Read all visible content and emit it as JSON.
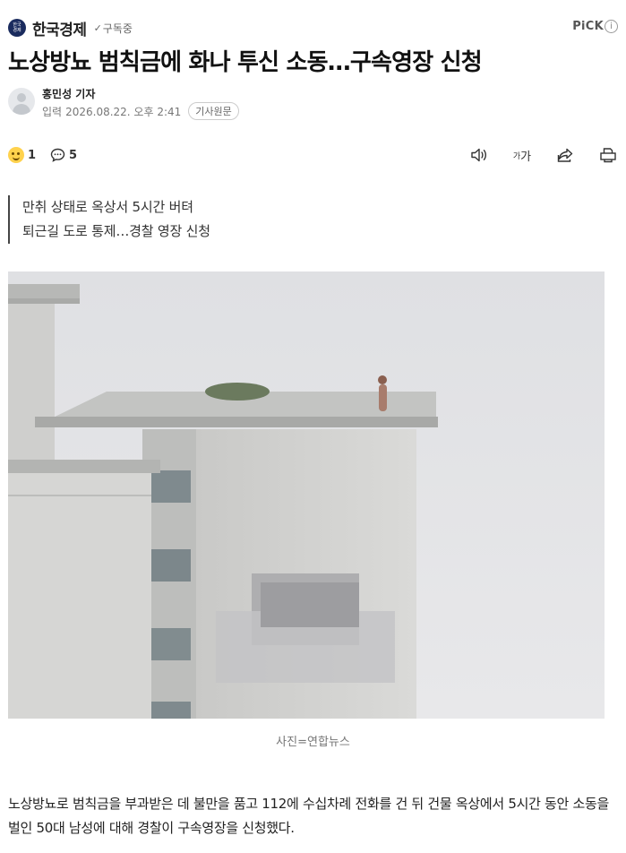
{
  "press": {
    "logo_text": "한국\n경제",
    "name": "한국경제",
    "subscribe_label": "구독중",
    "pick_label": "PiCK",
    "info_label": "i"
  },
  "article": {
    "headline": "노상방뇨 범칙금에 화나 투신 소동…구속영장 신청",
    "reporter": "홍민성 기자",
    "input_label": "입력",
    "published": "2026.08.22. 오후 2:41",
    "original_button": "기사원문",
    "reactions": {
      "emoji": "smile-icon",
      "count": "1",
      "comment_count": "5"
    },
    "tool_icons": [
      "speaker-icon",
      "font-size-icon",
      "share-icon",
      "print-icon"
    ],
    "font_size_label_small": "가",
    "font_size_label_big": "가",
    "summary": [
      "만취 상태로 옥상서 5시간 버텨",
      "퇴근길 도로 통제…경찰 영장 신청"
    ],
    "photo_caption": "사진=연합뉴스",
    "body": "노상방뇨로 범칙금을 부과받은 데 불만을 품고 112에 수십차례 전화를 건 뒤 건물 옥상에서 5시간 동안 소동을 벌인 50대 남성에 대해 경찰이 구속영장을 신청했다."
  }
}
